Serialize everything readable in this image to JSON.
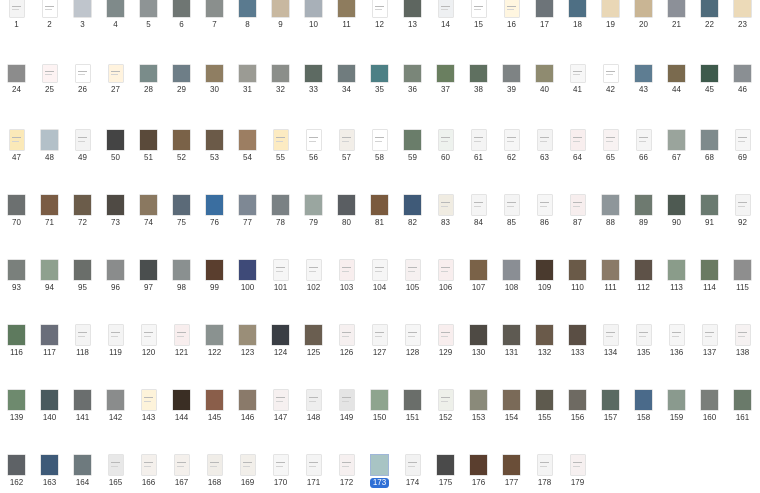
{
  "pages": [
    {
      "label": "1",
      "kind": "doc",
      "color": "#f4f4f4"
    },
    {
      "label": "2",
      "kind": "doc",
      "color": "#ffffff"
    },
    {
      "label": "3",
      "kind": "photo",
      "color": "#bfc5cc"
    },
    {
      "label": "4",
      "kind": "photo",
      "color": "#7f8a8a"
    },
    {
      "label": "5",
      "kind": "photo",
      "color": "#8e9495"
    },
    {
      "label": "6",
      "kind": "photo",
      "color": "#6f7673"
    },
    {
      "label": "7",
      "kind": "photo",
      "color": "#8a8f8d"
    },
    {
      "label": "8",
      "kind": "photo",
      "color": "#5a7a8f"
    },
    {
      "label": "9",
      "kind": "photo",
      "color": "#c8b8a0"
    },
    {
      "label": "10",
      "kind": "photo",
      "color": "#a8b0b8"
    },
    {
      "label": "11",
      "kind": "photo",
      "color": "#8e7c5e"
    },
    {
      "label": "12",
      "kind": "doc",
      "color": "#ffffff"
    },
    {
      "label": "13",
      "kind": "photo",
      "color": "#5e6660"
    },
    {
      "label": "14",
      "kind": "doc",
      "color": "#eef0f2"
    },
    {
      "label": "15",
      "kind": "doc",
      "color": "#ffffff"
    },
    {
      "label": "16",
      "kind": "doc",
      "color": "#fff6e0"
    },
    {
      "label": "17",
      "kind": "photo",
      "color": "#6d7479"
    },
    {
      "label": "18",
      "kind": "photo",
      "color": "#4e6f84"
    },
    {
      "label": "19",
      "kind": "photo",
      "color": "#e9d7b6"
    },
    {
      "label": "20",
      "kind": "photo",
      "color": "#c9b594"
    },
    {
      "label": "21",
      "kind": "photo",
      "color": "#8c9098"
    },
    {
      "label": "22",
      "kind": "photo",
      "color": "#4f6b7b"
    },
    {
      "label": "23",
      "kind": "photo",
      "color": "#ecdab8"
    },
    {
      "label": "24",
      "kind": "photo",
      "color": "#8c8c8c"
    },
    {
      "label": "25",
      "kind": "doc",
      "color": "#fdf3f3"
    },
    {
      "label": "26",
      "kind": "doc",
      "color": "#ffffff"
    },
    {
      "label": "27",
      "kind": "doc",
      "color": "#fff3de"
    },
    {
      "label": "28",
      "kind": "photo",
      "color": "#7a8c8a"
    },
    {
      "label": "29",
      "kind": "photo",
      "color": "#6e7e87"
    },
    {
      "label": "30",
      "kind": "photo",
      "color": "#8f7e62"
    },
    {
      "label": "31",
      "kind": "photo",
      "color": "#9b9b94"
    },
    {
      "label": "32",
      "kind": "photo",
      "color": "#8b8e8a"
    },
    {
      "label": "33",
      "kind": "photo",
      "color": "#5d6a62"
    },
    {
      "label": "34",
      "kind": "photo",
      "color": "#707c7e"
    },
    {
      "label": "35",
      "kind": "photo",
      "color": "#4d8085"
    },
    {
      "label": "36",
      "kind": "photo",
      "color": "#7a8679"
    },
    {
      "label": "37",
      "kind": "photo",
      "color": "#6a7f60"
    },
    {
      "label": "38",
      "kind": "photo",
      "color": "#5f7060"
    },
    {
      "label": "39",
      "kind": "photo",
      "color": "#7e8384"
    },
    {
      "label": "40",
      "kind": "photo",
      "color": "#8f8b70"
    },
    {
      "label": "41",
      "kind": "doc",
      "color": "#f7f7f7"
    },
    {
      "label": "42",
      "kind": "doc",
      "color": "#ffffff"
    },
    {
      "label": "43",
      "kind": "photo",
      "color": "#5e7d92"
    },
    {
      "label": "44",
      "kind": "photo",
      "color": "#7a6a4e"
    },
    {
      "label": "45",
      "kind": "photo",
      "color": "#3e5a4c"
    },
    {
      "label": "46",
      "kind": "photo",
      "color": "#8a8f93"
    },
    {
      "label": "47",
      "kind": "doc",
      "color": "#fbe9b8"
    },
    {
      "label": "48",
      "kind": "photo",
      "color": "#b3c0c8"
    },
    {
      "label": "49",
      "kind": "doc",
      "color": "#f3f3f3"
    },
    {
      "label": "50",
      "kind": "photo",
      "color": "#444444"
    },
    {
      "label": "51",
      "kind": "photo",
      "color": "#5a4a3a"
    },
    {
      "label": "52",
      "kind": "photo",
      "color": "#7a6248"
    },
    {
      "label": "53",
      "kind": "photo",
      "color": "#6b5a48"
    },
    {
      "label": "54",
      "kind": "photo",
      "color": "#9c7e62"
    },
    {
      "label": "55",
      "kind": "doc",
      "color": "#fcebc2"
    },
    {
      "label": "56",
      "kind": "doc",
      "color": "#ffffff"
    },
    {
      "label": "57",
      "kind": "doc",
      "color": "#f2eee8"
    },
    {
      "label": "58",
      "kind": "doc",
      "color": "#ffffff"
    },
    {
      "label": "59",
      "kind": "photo",
      "color": "#6a7d6a"
    },
    {
      "label": "60",
      "kind": "doc",
      "color": "#eef2ee"
    },
    {
      "label": "61",
      "kind": "doc",
      "color": "#f4f4f4"
    },
    {
      "label": "62",
      "kind": "doc",
      "color": "#f6f6f6"
    },
    {
      "label": "63",
      "kind": "doc",
      "color": "#f3f3f3"
    },
    {
      "label": "64",
      "kind": "doc",
      "color": "#f8eeee"
    },
    {
      "label": "65",
      "kind": "doc",
      "color": "#f8f2f2"
    },
    {
      "label": "66",
      "kind": "doc",
      "color": "#f5f5f5"
    },
    {
      "label": "67",
      "kind": "photo",
      "color": "#9aa49c"
    },
    {
      "label": "68",
      "kind": "photo",
      "color": "#7e8a8c"
    },
    {
      "label": "69",
      "kind": "doc",
      "color": "#f6f6f6"
    },
    {
      "label": "70",
      "kind": "photo",
      "color": "#6c7070"
    },
    {
      "label": "71",
      "kind": "photo",
      "color": "#7a5c44"
    },
    {
      "label": "72",
      "kind": "photo",
      "color": "#6b5c4a"
    },
    {
      "label": "73",
      "kind": "photo",
      "color": "#4f4a44"
    },
    {
      "label": "74",
      "kind": "photo",
      "color": "#8a7860"
    },
    {
      "label": "75",
      "kind": "photo",
      "color": "#5b6a78"
    },
    {
      "label": "76",
      "kind": "photo",
      "color": "#3a6ea0"
    },
    {
      "label": "77",
      "kind": "photo",
      "color": "#7e8894"
    },
    {
      "label": "78",
      "kind": "photo",
      "color": "#7a8184"
    },
    {
      "label": "79",
      "kind": "photo",
      "color": "#9aa6a0"
    },
    {
      "label": "80",
      "kind": "photo",
      "color": "#5a5e62"
    },
    {
      "label": "81",
      "kind": "photo",
      "color": "#7a5a3e"
    },
    {
      "label": "82",
      "kind": "photo",
      "color": "#3f5a78"
    },
    {
      "label": "83",
      "kind": "doc",
      "color": "#f0ece2"
    },
    {
      "label": "84",
      "kind": "doc",
      "color": "#f5f5f5"
    },
    {
      "label": "85",
      "kind": "doc",
      "color": "#f4f4f4"
    },
    {
      "label": "86",
      "kind": "doc",
      "color": "#f6f6f6"
    },
    {
      "label": "87",
      "kind": "doc",
      "color": "#f7eeee"
    },
    {
      "label": "88",
      "kind": "photo",
      "color": "#8e969a"
    },
    {
      "label": "89",
      "kind": "photo",
      "color": "#6e7a70"
    },
    {
      "label": "90",
      "kind": "photo",
      "color": "#4e5a52"
    },
    {
      "label": "91",
      "kind": "photo",
      "color": "#6a7a70"
    },
    {
      "label": "92",
      "kind": "doc",
      "color": "#f4f4f4"
    },
    {
      "label": "93",
      "kind": "photo",
      "color": "#7a807c"
    },
    {
      "label": "94",
      "kind": "photo",
      "color": "#8ea08e"
    },
    {
      "label": "95",
      "kind": "photo",
      "color": "#6a6e6a"
    },
    {
      "label": "96",
      "kind": "photo",
      "color": "#8a8c8c"
    },
    {
      "label": "97",
      "kind": "photo",
      "color": "#4a4e4e"
    },
    {
      "label": "98",
      "kind": "photo",
      "color": "#8a9090"
    },
    {
      "label": "99",
      "kind": "photo",
      "color": "#5a3e2e"
    },
    {
      "label": "100",
      "kind": "photo",
      "color": "#3e4a78"
    },
    {
      "label": "101",
      "kind": "doc",
      "color": "#f6f6f6"
    },
    {
      "label": "102",
      "kind": "doc",
      "color": "#f6f6f6"
    },
    {
      "label": "103",
      "kind": "doc",
      "color": "#f8eeee"
    },
    {
      "label": "104",
      "kind": "doc",
      "color": "#f6f6f6"
    },
    {
      "label": "105",
      "kind": "doc",
      "color": "#f6f0f0"
    },
    {
      "label": "106",
      "kind": "doc",
      "color": "#f8eeee"
    },
    {
      "label": "107",
      "kind": "photo",
      "color": "#7a6248"
    },
    {
      "label": "108",
      "kind": "photo",
      "color": "#8a8e94"
    },
    {
      "label": "109",
      "kind": "photo",
      "color": "#4a3a2e"
    },
    {
      "label": "110",
      "kind": "photo",
      "color": "#6a5a48"
    },
    {
      "label": "111",
      "kind": "photo",
      "color": "#8a7a68"
    },
    {
      "label": "112",
      "kind": "photo",
      "color": "#5e5248"
    },
    {
      "label": "113",
      "kind": "photo",
      "color": "#8a9c8a"
    },
    {
      "label": "114",
      "kind": "photo",
      "color": "#6a7a62"
    },
    {
      "label": "115",
      "kind": "photo",
      "color": "#8e8e8e"
    },
    {
      "label": "116",
      "kind": "photo",
      "color": "#5e7a5e"
    },
    {
      "label": "117",
      "kind": "photo",
      "color": "#6a6e7a"
    },
    {
      "label": "118",
      "kind": "doc",
      "color": "#f4f4f4"
    },
    {
      "label": "119",
      "kind": "doc",
      "color": "#f4f4f4"
    },
    {
      "label": "120",
      "kind": "doc",
      "color": "#f6f6f6"
    },
    {
      "label": "121",
      "kind": "doc",
      "color": "#f8eeee"
    },
    {
      "label": "122",
      "kind": "photo",
      "color": "#8a9290"
    },
    {
      "label": "123",
      "kind": "photo",
      "color": "#9a8e78"
    },
    {
      "label": "124",
      "kind": "photo",
      "color": "#3a3e44"
    },
    {
      "label": "125",
      "kind": "photo",
      "color": "#6a5e50"
    },
    {
      "label": "126",
      "kind": "doc",
      "color": "#f6f0f0"
    },
    {
      "label": "127",
      "kind": "doc",
      "color": "#f5f5f5"
    },
    {
      "label": "128",
      "kind": "doc",
      "color": "#f6f6f6"
    },
    {
      "label": "129",
      "kind": "doc",
      "color": "#f8eeee"
    },
    {
      "label": "130",
      "kind": "photo",
      "color": "#4e4a44"
    },
    {
      "label": "131",
      "kind": "photo",
      "color": "#5e5a52"
    },
    {
      "label": "132",
      "kind": "photo",
      "color": "#6a5a4a"
    },
    {
      "label": "133",
      "kind": "photo",
      "color": "#5a4e44"
    },
    {
      "label": "134",
      "kind": "doc",
      "color": "#f4f4f4"
    },
    {
      "label": "135",
      "kind": "doc",
      "color": "#f4f4f4"
    },
    {
      "label": "136",
      "kind": "doc",
      "color": "#f6f6f6"
    },
    {
      "label": "137",
      "kind": "doc",
      "color": "#f5f5f5"
    },
    {
      "label": "138",
      "kind": "doc",
      "color": "#f6f2f2"
    },
    {
      "label": "139",
      "kind": "photo",
      "color": "#6e8a6e"
    },
    {
      "label": "140",
      "kind": "photo",
      "color": "#4a5a5e"
    },
    {
      "label": "141",
      "kind": "photo",
      "color": "#6a6e6e"
    },
    {
      "label": "142",
      "kind": "photo",
      "color": "#8a8c8c"
    },
    {
      "label": "143",
      "kind": "doc",
      "color": "#fdf3da"
    },
    {
      "label": "144",
      "kind": "photo",
      "color": "#3a2e24"
    },
    {
      "label": "145",
      "kind": "photo",
      "color": "#8a5e4a"
    },
    {
      "label": "146",
      "kind": "photo",
      "color": "#8a7a6a"
    },
    {
      "label": "147",
      "kind": "doc",
      "color": "#f6f0f0"
    },
    {
      "label": "148",
      "kind": "doc",
      "color": "#eeeeee"
    },
    {
      "label": "149",
      "kind": "doc",
      "color": "#e4e4e4"
    },
    {
      "label": "150",
      "kind": "photo",
      "color": "#8ea48e"
    },
    {
      "label": "151",
      "kind": "photo",
      "color": "#6a6e6a"
    },
    {
      "label": "152",
      "kind": "doc",
      "color": "#eef0ea"
    },
    {
      "label": "153",
      "kind": "photo",
      "color": "#8a8a7a"
    },
    {
      "label": "154",
      "kind": "photo",
      "color": "#7a6a58"
    },
    {
      "label": "155",
      "kind": "photo",
      "color": "#5e5a4e"
    },
    {
      "label": "156",
      "kind": "photo",
      "color": "#6e6a62"
    },
    {
      "label": "157",
      "kind": "photo",
      "color": "#5a6a62"
    },
    {
      "label": "158",
      "kind": "photo",
      "color": "#4a6a8a"
    },
    {
      "label": "159",
      "kind": "photo",
      "color": "#8a9a8e"
    },
    {
      "label": "160",
      "kind": "photo",
      "color": "#7a7e7a"
    },
    {
      "label": "161",
      "kind": "photo",
      "color": "#6a7a6a"
    },
    {
      "label": "162",
      "kind": "photo",
      "color": "#5e6266"
    },
    {
      "label": "163",
      "kind": "photo",
      "color": "#3e5a78"
    },
    {
      "label": "164",
      "kind": "photo",
      "color": "#6e7a7e"
    },
    {
      "label": "165",
      "kind": "doc",
      "color": "#e8e8e8"
    },
    {
      "label": "166",
      "kind": "doc",
      "color": "#f4f0ec"
    },
    {
      "label": "167",
      "kind": "doc",
      "color": "#f4f0ec"
    },
    {
      "label": "168",
      "kind": "doc",
      "color": "#f0ede8"
    },
    {
      "label": "169",
      "kind": "doc",
      "color": "#f2efea"
    },
    {
      "label": "170",
      "kind": "doc",
      "color": "#f6f6f6"
    },
    {
      "label": "171",
      "kind": "doc",
      "color": "#f4f4f4"
    },
    {
      "label": "172",
      "kind": "doc",
      "color": "#f6f0f0"
    },
    {
      "label": "173",
      "kind": "photo",
      "color": "#a8c4c4"
    },
    {
      "label": "174",
      "kind": "doc",
      "color": "#f2f2f2"
    },
    {
      "label": "175",
      "kind": "photo",
      "color": "#4a4a4a"
    },
    {
      "label": "176",
      "kind": "photo",
      "color": "#5a3e2e"
    },
    {
      "label": "177",
      "kind": "photo",
      "color": "#6a4e38"
    },
    {
      "label": "178",
      "kind": "doc",
      "color": "#f4f4f4"
    },
    {
      "label": "179",
      "kind": "doc",
      "color": "#f6f0f0"
    }
  ],
  "selected_page": "173",
  "colors": {
    "selection_badge": "#2f6fd6",
    "label_text": "#333333",
    "background": "#ffffff"
  }
}
